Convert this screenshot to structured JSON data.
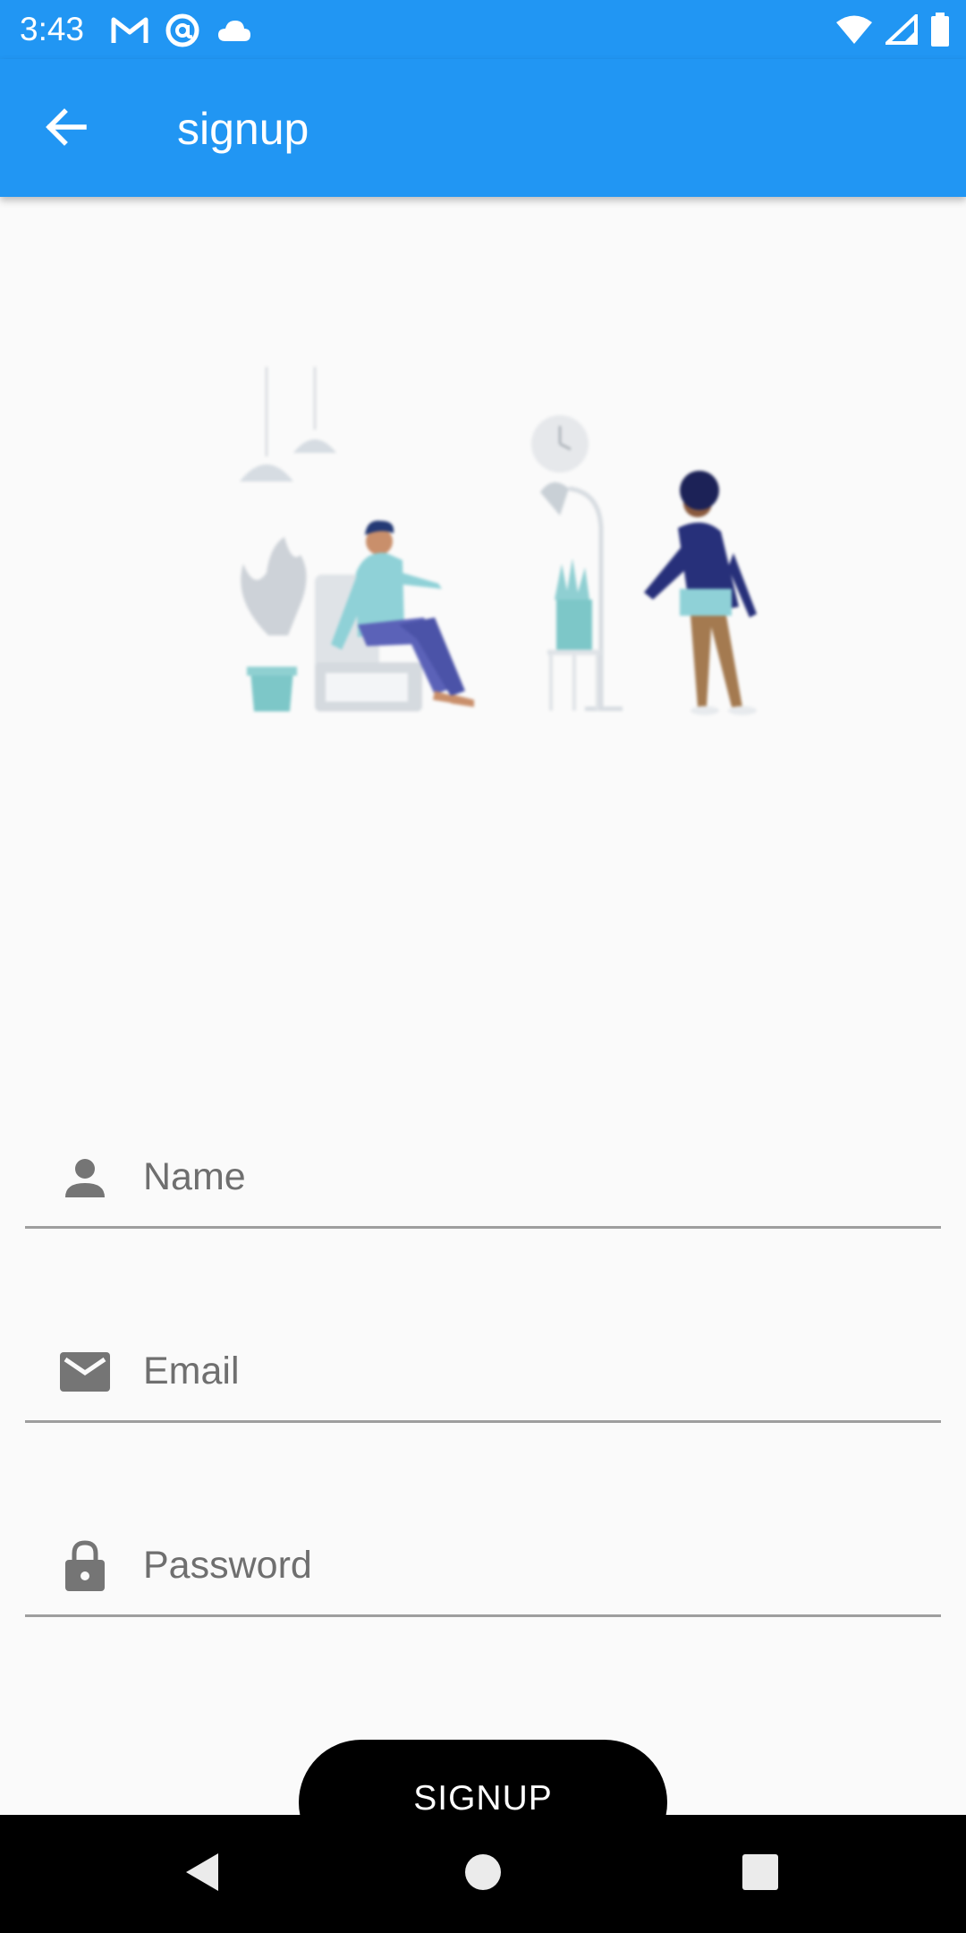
{
  "status_bar": {
    "time": "3:43",
    "left_icons": [
      "gmail-icon",
      "at-sign-icon",
      "cloud-icon"
    ],
    "right_icons": [
      "wifi-icon",
      "signal-icon",
      "battery-icon"
    ]
  },
  "app_bar": {
    "title": "signup",
    "back_icon": "arrow-back-icon",
    "color": "#2196f3"
  },
  "form": {
    "name": {
      "placeholder": "Name",
      "value": "",
      "icon": "person-icon"
    },
    "email": {
      "placeholder": "Email",
      "value": "",
      "icon": "mail-icon"
    },
    "password": {
      "placeholder": "Password",
      "value": "",
      "icon": "lock-icon"
    }
  },
  "signup_button": {
    "label": "SIGNUP"
  },
  "nav_bar": {
    "buttons": [
      "back-triangle-icon",
      "home-circle-icon",
      "recents-square-icon"
    ]
  }
}
